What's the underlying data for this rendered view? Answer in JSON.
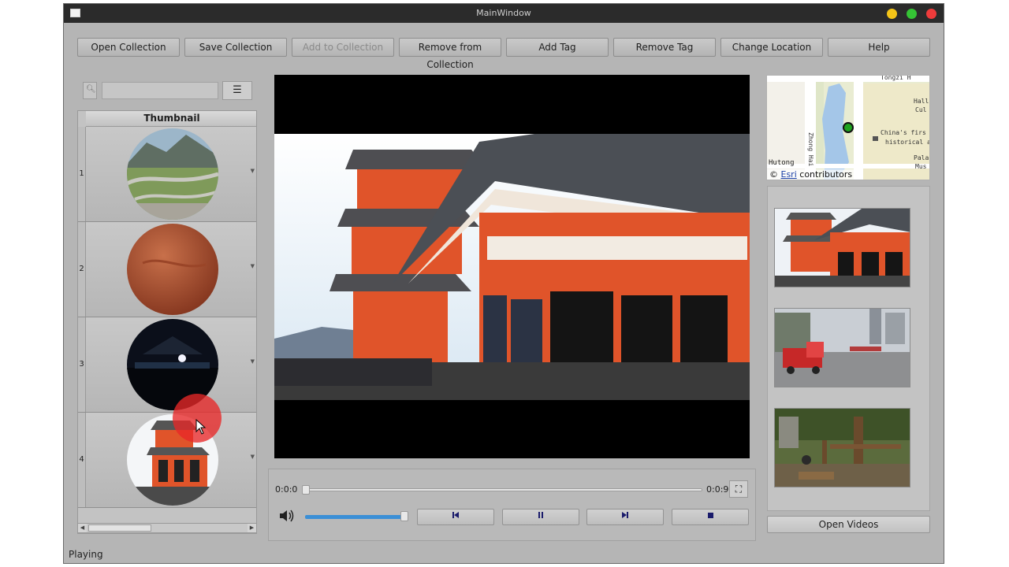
{
  "window": {
    "title": "MainWindow"
  },
  "toolbar": {
    "buttons": [
      {
        "label": "Open Collection",
        "enabled": true
      },
      {
        "label": "Save Collection",
        "enabled": true
      },
      {
        "label": "Add to Collection",
        "enabled": false
      },
      {
        "label": "Remove from Collection",
        "enabled": true
      },
      {
        "label": "Add Tag",
        "enabled": true
      },
      {
        "label": "Remove Tag",
        "enabled": true
      },
      {
        "label": "Change Location",
        "enabled": true
      },
      {
        "label": "Help",
        "enabled": true
      }
    ]
  },
  "search": {
    "value": "",
    "placeholder": ""
  },
  "thumbnails": {
    "header": "Thumbnail",
    "rows": [
      {
        "num": "1",
        "image": "mountain-road"
      },
      {
        "num": "2",
        "image": "red-closeup"
      },
      {
        "num": "3",
        "image": "night-crowd"
      },
      {
        "num": "4",
        "image": "pagoda"
      }
    ]
  },
  "player": {
    "current_time": "0:0:0",
    "total_time": "0:0:9",
    "progress": 0.0,
    "volume": 1.0,
    "state": "playing"
  },
  "map": {
    "labels": {
      "tongzi": "Tongzi H",
      "hall": "Hall",
      "cul": "Cul",
      "zhong_hai": "Zhong Hai",
      "china_first": "China's firs",
      "historical": "historical a",
      "hutong": "Hutong",
      "pala": "Pala",
      "mus": "Mus"
    },
    "attribution_prefix": "©",
    "attribution_link": "Esri",
    "attribution_suffix": "contributors"
  },
  "gallery": {
    "items": [
      "pagoda-video",
      "street-video",
      "zoo-video"
    ]
  },
  "open_videos_label": "Open Videos",
  "status": {
    "text": "Playing"
  },
  "colors": {
    "titlebar": "#2b2b2b",
    "accent": "#3b8fd6",
    "pagoda": "#e0542a",
    "marker": "#e82828"
  }
}
